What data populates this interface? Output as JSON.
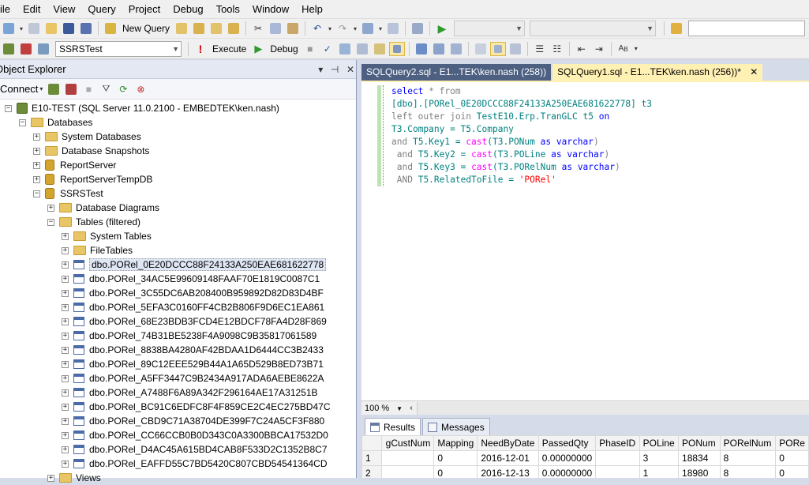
{
  "menu": [
    "ile",
    "Edit",
    "View",
    "Query",
    "Project",
    "Debug",
    "Tools",
    "Window",
    "Help"
  ],
  "toolbar1": {
    "new_query_label": "New Query"
  },
  "toolbar2": {
    "database": "SSRSTest",
    "execute_label": "Execute",
    "debug_label": "Debug"
  },
  "object_explorer": {
    "title": "Object Explorer",
    "connect_label": "Connect",
    "server": "E10-TEST (SQL Server 11.0.2100 - EMBEDTEK\\ken.nash)",
    "databases_label": "Databases",
    "system_databases": "System Databases",
    "database_snapshots": "Database Snapshots",
    "db1": "ReportServer",
    "db2": "ReportServerTempDB",
    "db3": "SSRSTest",
    "database_diagrams": "Database Diagrams",
    "tables_filtered": "Tables (filtered)",
    "system_tables": "System Tables",
    "file_tables": "FileTables",
    "tables": [
      "dbo.PORel_0E20DCCC88F24133A250EAE681622778",
      "dbo.PORel_34AC5E99609148FAAF70E1819C0087C1",
      "dbo.PORel_3C55DC6AB208400B959892D82D83D4BF",
      "dbo.PORel_5EFA3C0160FF4CB2B806F9D6EC1EA861",
      "dbo.PORel_68E23BDB3FCD4E12BDCF78FA4D28F869",
      "dbo.PORel_74B31BE5238F4A9098C9B35817061589",
      "dbo.PORel_8838BA4280AF42BDAA1D6444CC3B2433",
      "dbo.PORel_89C12EEE529B44A1A65D529B8ED73B71",
      "dbo.PORel_A5FF3447C9B2434A917ADA6AEBE8622A",
      "dbo.PORel_A7488F6A89A342F296164AE17A31251B",
      "dbo.PORel_BC91C6EDFC8F4F859CE2C4EC275BD47C",
      "dbo.PORel_CBD9C71A38704DE399F7C24A5CF3F880",
      "dbo.PORel_CC66CCB0B0D343C0A3300BBCA17532D0",
      "dbo.PORel_D4AC45A615BD4CAB8F533D2C1352B8C7",
      "dbo.PORel_EAFFD55C7BD5420C807CBD54541364CD"
    ],
    "views_label": "Views"
  },
  "tabs": [
    {
      "label": "SQLQuery2.sql - E1...TEK\\ken.nash (258))"
    },
    {
      "label": "SQLQuery1.sql - E1...TEK\\ken.nash (256))*"
    }
  ],
  "code": {
    "l1_kw": "select",
    "l1_rest": " * from",
    "l2": "[dbo].[PORel_0E20DCCC88F24133A250EAE681622778] t3",
    "l3_kw": "left outer join",
    "l3_obj": " TestE10.Erp.TranGLC",
    "l3_rest": " t5 ",
    "l3_on": "on",
    "l4": "T3.Company = T5.Company",
    "and": "and",
    "AND": "AND",
    "l5_a": " T5.Key1 = ",
    "cast": "cast",
    "l5_b": "(T3.PONum ",
    "as": "as",
    "varchar": "varchar",
    "close": ")",
    "l6_a": " T5.Key2 = ",
    "l6_b": "(T3.POLine ",
    "l7_a": " T5.Key3 = ",
    "l7_b": "(T3.PORelNum ",
    "l8_a": " T5.RelatedToFile = ",
    "l8_str": "'PORel'"
  },
  "zoom": "100 %",
  "results": {
    "tab_results": "Results",
    "tab_messages": "Messages",
    "columns": [
      "gCustNum",
      "Mapping",
      "NeedByDate",
      "PassedQty",
      "PhaseID",
      "POLine",
      "PONum",
      "PORelNum",
      "PORe"
    ],
    "rows": [
      {
        "n": "1",
        "cells": [
          "",
          "0",
          "2016-12-01",
          "0.00000000",
          "",
          "3",
          "18834",
          "8",
          "0"
        ]
      },
      {
        "n": "2",
        "cells": [
          "",
          "0",
          "2016-12-13",
          "0.00000000",
          "",
          "1",
          "18980",
          "8",
          "0"
        ]
      }
    ]
  }
}
